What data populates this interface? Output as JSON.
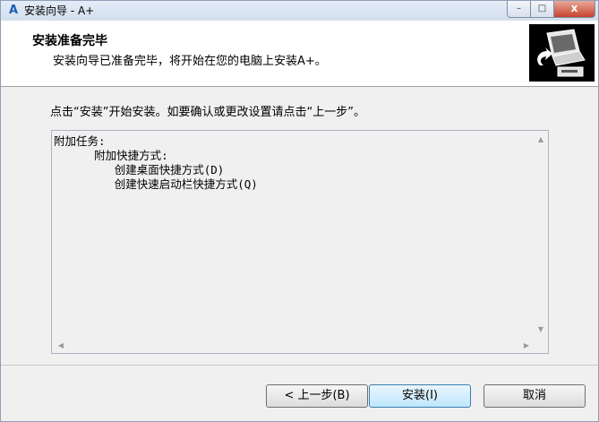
{
  "window": {
    "title": "安装向导 - A+",
    "app_icon": "A"
  },
  "header": {
    "title": "安装准备完毕",
    "subtitle": "安装向导已准备完毕，将开始在您的电脑上安装A+。"
  },
  "content": {
    "instruction": "点击“安装”开始安装。如要确认或更改设置请点击“上一步”。",
    "memo_lines": [
      "附加任务:",
      "      附加快捷方式:",
      "         创建桌面快捷方式(D)",
      "         创建快速启动栏快捷方式(Q)"
    ]
  },
  "buttons": {
    "back": "< 上一步(B)",
    "install": "安装(I)",
    "cancel": "取消"
  },
  "controls": {
    "minimize": "–",
    "maximize": "□",
    "close": "x"
  }
}
